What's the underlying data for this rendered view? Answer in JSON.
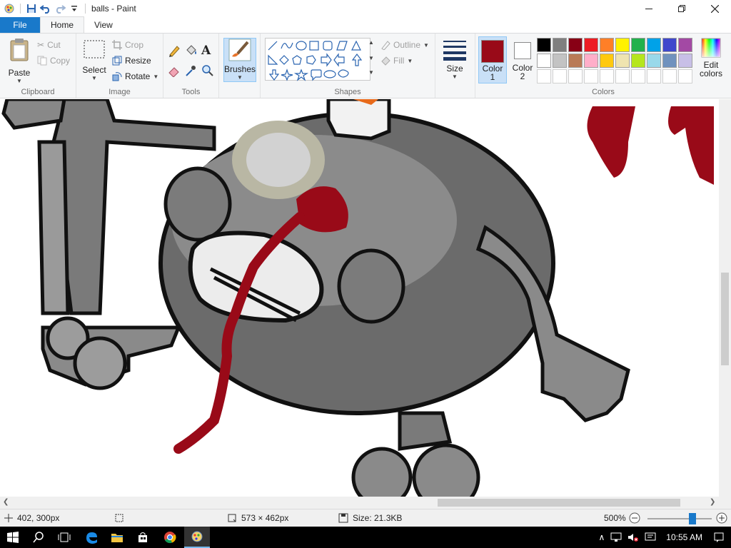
{
  "window": {
    "title": "balls - Paint"
  },
  "tabs": {
    "file": "File",
    "home": "Home",
    "view": "View"
  },
  "clipboard": {
    "paste": "Paste",
    "cut": "Cut",
    "copy": "Copy",
    "label": "Clipboard"
  },
  "image": {
    "select": "Select",
    "crop": "Crop",
    "resize": "Resize",
    "rotate": "Rotate",
    "label": "Image"
  },
  "tools": {
    "label": "Tools"
  },
  "brushes": {
    "label": "Brushes"
  },
  "shapes": {
    "outline": "Outline",
    "fill": "Fill",
    "label": "Shapes"
  },
  "size": {
    "label": "Size"
  },
  "colors": {
    "color1_label": "Color 1",
    "color1_line1": "Color",
    "color1_line2": "1",
    "color2_line1": "Color",
    "color2_line2": "2",
    "edit_line1": "Edit",
    "edit_line2": "colors",
    "label": "Colors",
    "color1_value": "#990a18",
    "color2_value": "#ffffff",
    "palette_row1": [
      "#000000",
      "#7f7f7f",
      "#880015",
      "#ed1c24",
      "#ff7f27",
      "#fff200",
      "#22b14c",
      "#00a2e8",
      "#3f48cc",
      "#a349a4"
    ],
    "palette_row2": [
      "#ffffff",
      "#c3c3c3",
      "#b97a57",
      "#ffaec9",
      "#ffc90e",
      "#efe4b0",
      "#b5e61d",
      "#99d9ea",
      "#7092be",
      "#c8bfe7"
    ],
    "palette_row3": [
      "#ffffff",
      "#ffffff",
      "#ffffff",
      "#ffffff",
      "#ffffff",
      "#ffffff",
      "#ffffff",
      "#ffffff",
      "#ffffff",
      "#ffffff"
    ]
  },
  "status": {
    "cursor_pos": "402, 300px",
    "selection_size": "",
    "canvas_size": "573 × 462px",
    "file_size": "Size: 21.3KB",
    "zoom": "500%",
    "zoom_level_fraction": 0.7
  },
  "taskbar": {
    "time": "10:55 AM"
  }
}
